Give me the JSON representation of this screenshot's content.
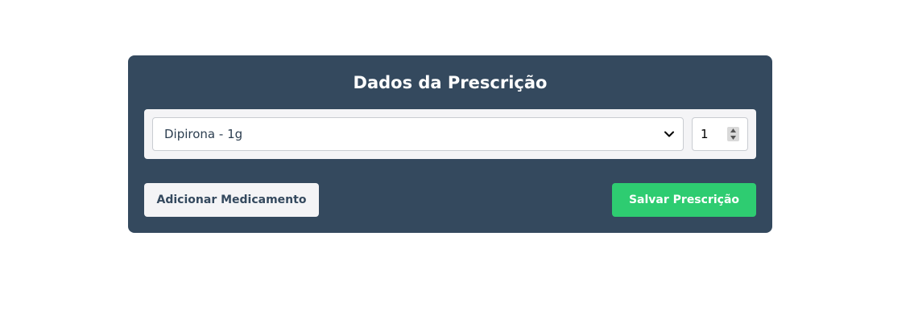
{
  "form": {
    "title": "Dados da Prescrição",
    "medication_select": {
      "selected": "Dipirona - 1g"
    },
    "quantity": {
      "value": "1"
    },
    "add_button_label": "Adicionar Medicamento",
    "save_button_label": "Salvar Prescrição"
  },
  "colors": {
    "card_background": "#34495e",
    "save_button": "#2ecc71",
    "light_panel": "#f4f4f6"
  },
  "icons": {
    "select_chevron": "chevron-down-icon",
    "spin_up": "caret-up-icon",
    "spin_down": "caret-down-icon"
  }
}
